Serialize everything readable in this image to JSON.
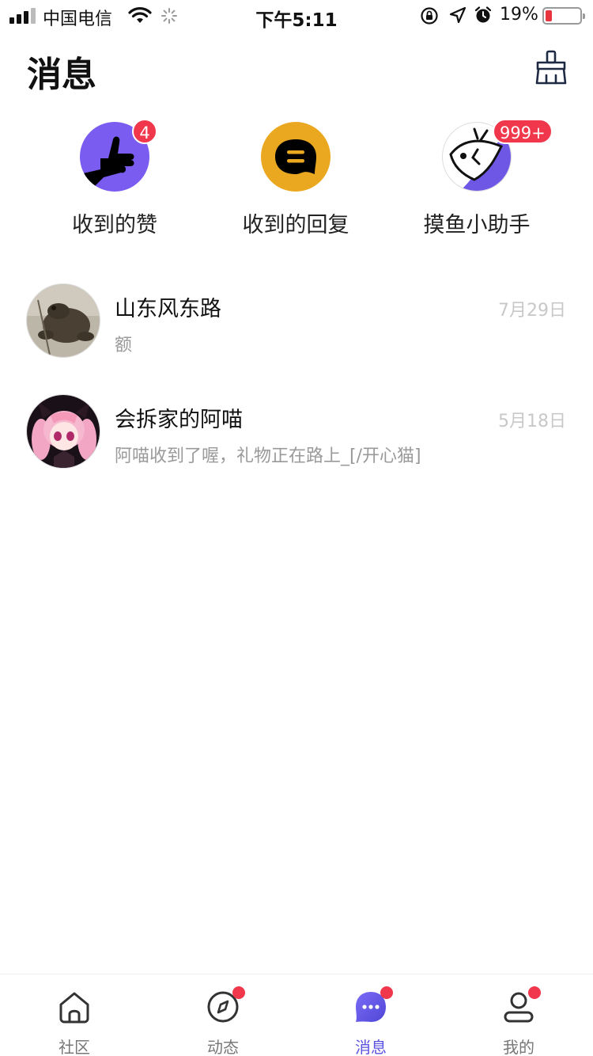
{
  "status_bar": {
    "carrier": "中国电信",
    "time": "下午5:11",
    "battery_percent": "19%",
    "battery_level": 0.19,
    "icons": [
      "signal-icon",
      "wifi-icon",
      "loading-spinner-icon",
      "rotation-lock-icon",
      "location-icon",
      "alarm-icon",
      "battery-icon"
    ]
  },
  "header": {
    "title": "消息",
    "clear_icon": "broom-icon"
  },
  "quick_entries": [
    {
      "label": "收到的赞",
      "badge": "4",
      "icon": "thumbs-up-icon",
      "color": "#7b5cf0"
    },
    {
      "label": "收到的回复",
      "badge": "",
      "icon": "reply-bubble-icon",
      "color": "#eaa820"
    },
    {
      "label": "摸鱼小助手",
      "badge": "999+",
      "icon": "fish-icon",
      "color": "#6f57e6"
    }
  ],
  "conversations": [
    {
      "name": "山东风东路",
      "preview": "额",
      "date": "7月29日",
      "avatar": "toad-photo-avatar"
    },
    {
      "name": "会拆家的阿喵",
      "preview": "阿喵收到了喔，礼物正在路上_[/开心猫]",
      "date": "5月18日",
      "avatar": "anime-girl-avatar"
    }
  ],
  "tab_bar": {
    "active": "消息",
    "accent": "#5a52e0",
    "tabs": [
      {
        "label": "社区",
        "icon": "home-icon",
        "dot": false
      },
      {
        "label": "动态",
        "icon": "compass-icon",
        "dot": true
      },
      {
        "label": "消息",
        "icon": "message-icon",
        "dot": true
      },
      {
        "label": "我的",
        "icon": "profile-icon",
        "dot": true
      }
    ]
  }
}
